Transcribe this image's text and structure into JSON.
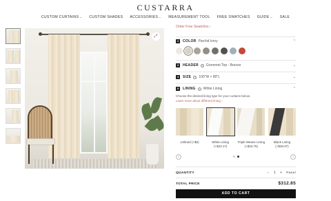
{
  "brand": {
    "logo": "CUSTARRA"
  },
  "nav": {
    "items": [
      {
        "label": "CUSTOM CURTAINS",
        "has_dropdown": true
      },
      {
        "label": "CUSTOM SHADES",
        "has_dropdown": false
      },
      {
        "label": "ACCESSORIES",
        "has_dropdown": true
      },
      {
        "label": "MEASUREMENT TOOL",
        "has_dropdown": false
      },
      {
        "label": "FREE SWATCHES",
        "has_dropdown": false
      },
      {
        "label": "GUIDE",
        "has_dropdown": true
      },
      {
        "label": "SALE",
        "has_dropdown": false
      }
    ],
    "chevron": "⌄"
  },
  "gallery": {
    "thumbnail_count": 6,
    "zoom_icon": "expand-icon"
  },
  "config": {
    "swatch_link": "Order Free Swatches ›",
    "sections": [
      {
        "num": "2",
        "label": "COLOR",
        "value": "Parchd Ivory",
        "expanded": true
      },
      {
        "num": "3",
        "label": "HEADER",
        "value": "Grommet Top - Bronze",
        "expanded": false
      },
      {
        "num": "4",
        "label": "SIZE",
        "value": "100\"W × 80\"L",
        "expanded": false
      },
      {
        "num": "5",
        "label": "LINING",
        "value": "White Lining",
        "expanded": true
      }
    ],
    "colors": [
      "#ece9e2",
      "#d7d2c6",
      "#a9a497",
      "#8f9088",
      "#6f716c",
      "#4f524e",
      "#9fb0b8",
      "#c24b3b"
    ],
    "selected_color_index": 1,
    "lining_description": "Choose the desired lining type for your curtains below.",
    "lining_link": "Learn more about different lining ›",
    "linings": [
      {
        "label": "Unlined (+$0)",
        "selected": false
      },
      {
        "label": "White Lining (+$23.17)",
        "selected": true
      },
      {
        "label": "Triple Weave Lining (+$34.76)",
        "selected": false
      },
      {
        "label": "Black Lining (+$28.07)",
        "selected": false
      }
    ],
    "carousel": {
      "pages": 2,
      "current": 1,
      "prev": "‹",
      "next": "›"
    }
  },
  "purchase": {
    "qty_label": "QUANTITY",
    "minus": "−",
    "qty": "1",
    "plus": "+",
    "unit": "Panel",
    "total_label": "TOTAL PRICE",
    "total": "$312.85",
    "cta": "ADD TO CART"
  }
}
